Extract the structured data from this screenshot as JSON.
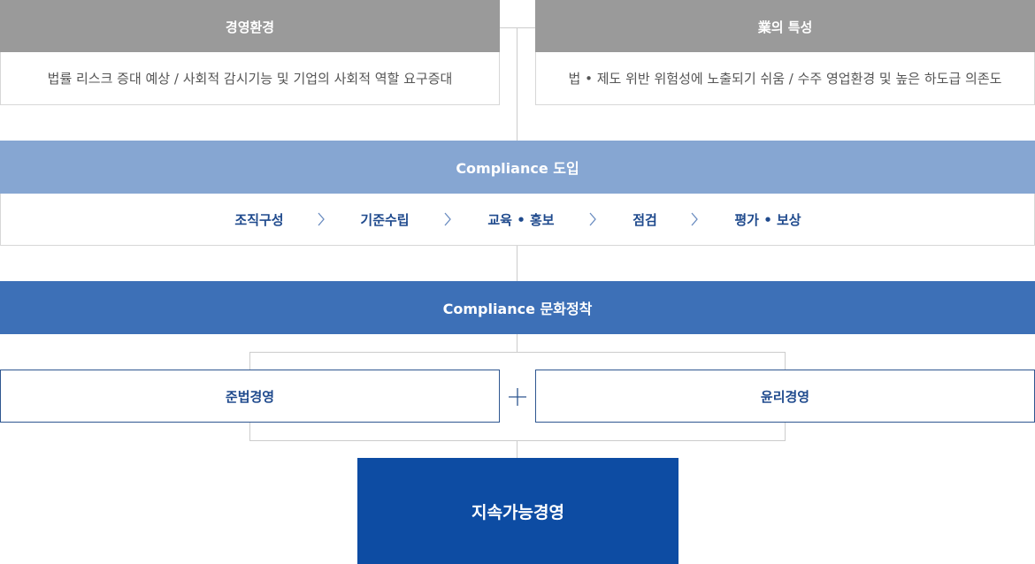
{
  "top_left": {
    "header": "경영환경",
    "description": "법률 리스크 증대 예상 / 사회적 감시기능 및 기업의 사회적 역할 요구증대"
  },
  "top_right": {
    "header": "業의 특성",
    "description": "법 • 제도 위반 위험성에 노출되기 쉬움 / 수주 영업환경 및 높은 하도급 의존도"
  },
  "compliance_intro": {
    "title": "Compliance 도입",
    "steps": [
      "조직구성",
      "기준수립",
      "교육 • 홍보",
      "점검",
      "평가 • 보상"
    ]
  },
  "compliance_culture": {
    "title": "Compliance 문화정착"
  },
  "pillars": {
    "left": "준법경영",
    "right": "윤리경영"
  },
  "result": {
    "title": "지속가능경영"
  },
  "colors": {
    "gray_header": "#9a9a9a",
    "light_blue": "#86a6d2",
    "mid_blue": "#3d70b7",
    "dark_blue": "#0d4ca3",
    "text_blue": "#1f4a8d"
  },
  "icons": {
    "step_separator": "chevron-right-icon",
    "plus": "plus-icon"
  }
}
